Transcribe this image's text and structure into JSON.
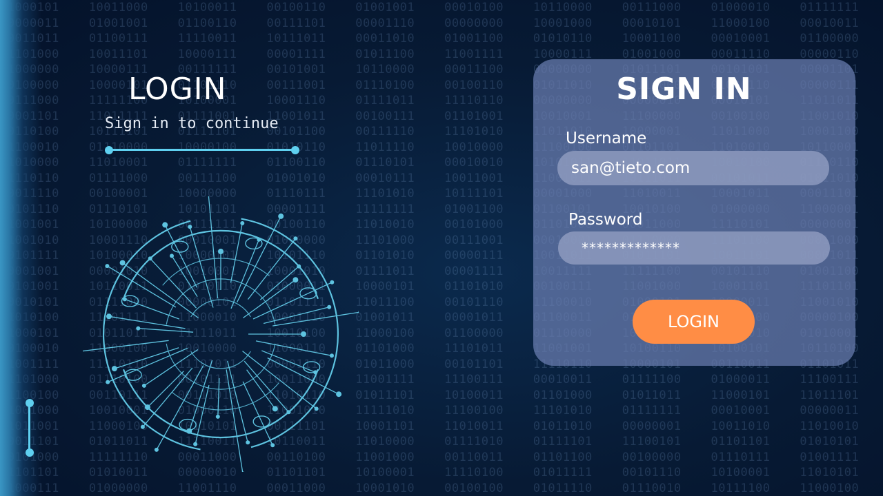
{
  "left": {
    "title": "LOGIN",
    "subtitle": "Sign in to continue"
  },
  "panel": {
    "title": "SIGN IN",
    "username": {
      "label": "Username",
      "value": "san@tieto.com"
    },
    "password": {
      "label": "Password",
      "value": "*************"
    },
    "login_button_label": "LOGIN"
  },
  "colors": {
    "accent": "#5fd0f0",
    "button": "#ff8d45",
    "panel": "#6b7eb2",
    "background": "#07172e"
  },
  "icons": {
    "circuit_emblem": "circuit-icon"
  }
}
